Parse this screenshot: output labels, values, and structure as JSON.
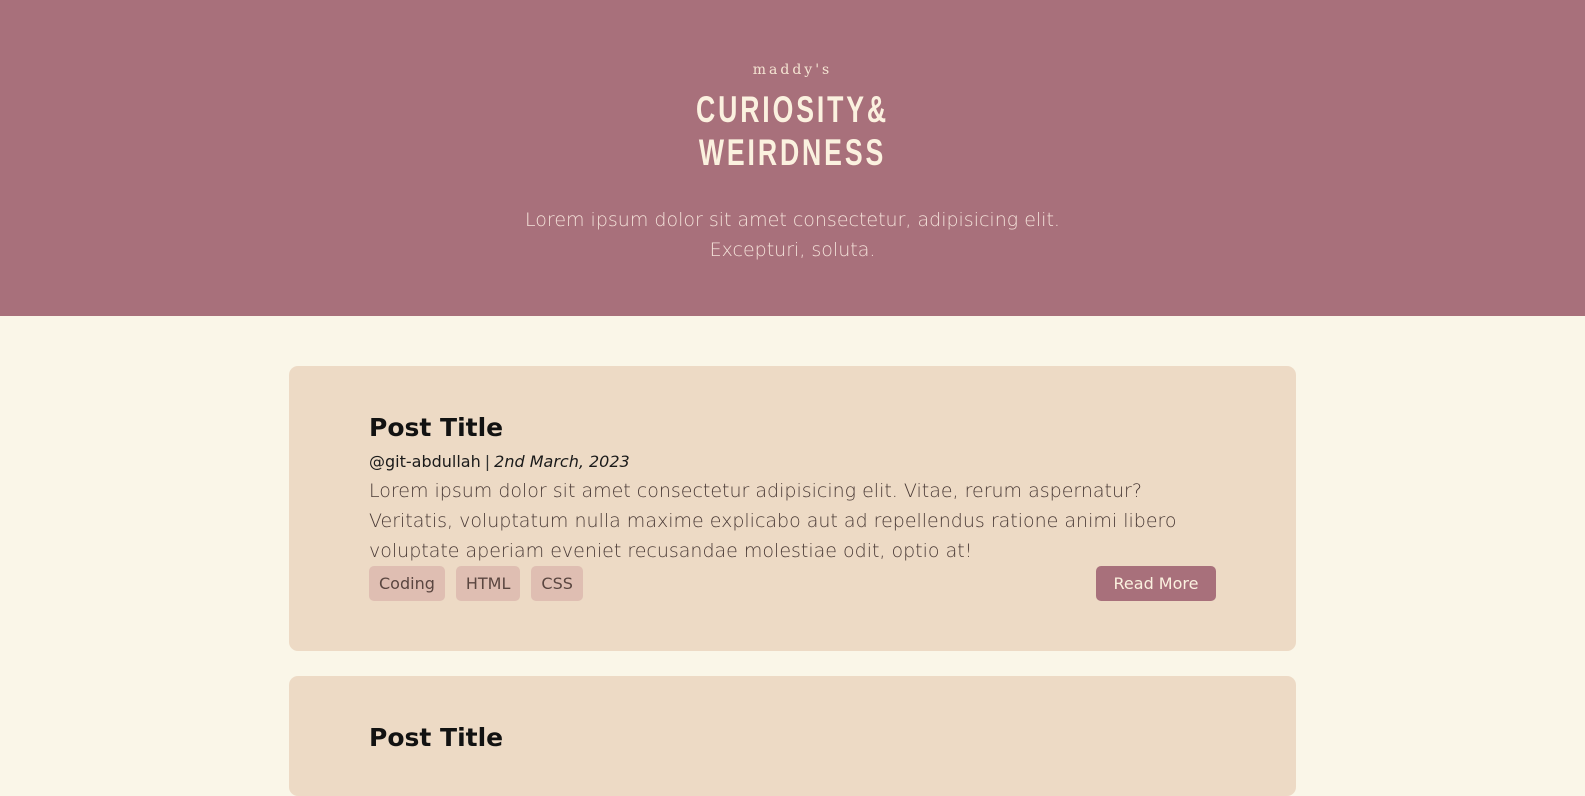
{
  "header": {
    "brand_small": "maddy's",
    "brand_line1": "CURIOSITY&",
    "brand_line2": "WEIRDNESS",
    "tagline_line1": "Lorem ipsum dolor sit amet consectetur, adipisicing elit.",
    "tagline_line2": "Excepturi, soluta."
  },
  "posts": [
    {
      "title": "Post Title",
      "author": "@git-abdullah",
      "separator": "|",
      "date": "2nd March, 2023",
      "excerpt": "Lorem ipsum dolor sit amet consectetur adipisicing elit. Vitae, rerum aspernatur? Veritatis, voluptatum nulla maxime explicabo aut ad repellendus ratione animi libero voluptate aperiam eveniet recusandae molestiae odit, optio at!",
      "tags": [
        "Coding",
        "HTML",
        "CSS"
      ],
      "read_more_label": "Read More"
    },
    {
      "title": "Post Title"
    }
  ],
  "colors": {
    "header_bg": "#a8707b",
    "page_bg": "#faf6e8",
    "card_bg": "#eddac5",
    "tag_bg": "#dfbeb2",
    "button_bg": "#a8707b"
  }
}
